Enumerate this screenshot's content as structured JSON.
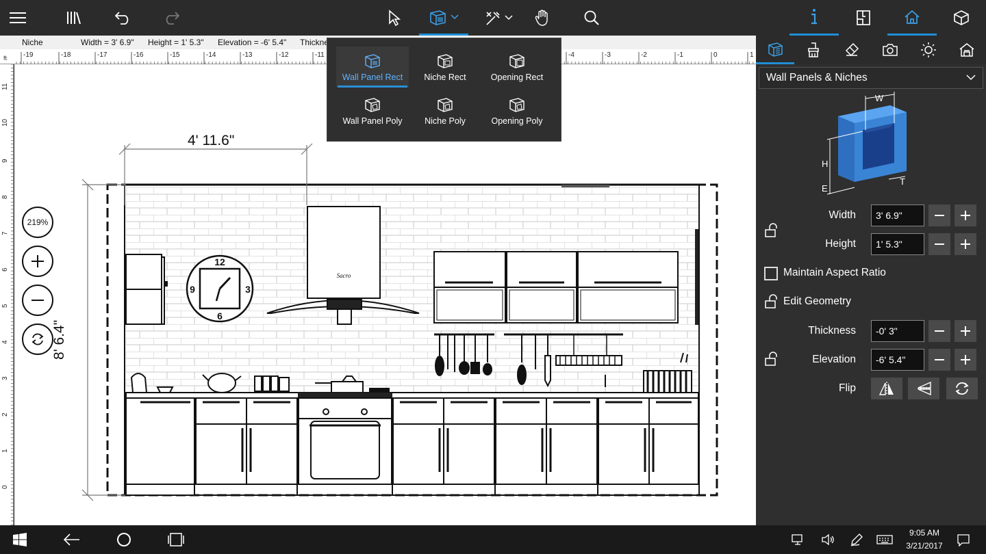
{
  "toolbar": {
    "icons": [
      "menu-icon",
      "library-icon",
      "undo-icon",
      "redo-icon",
      "select-arrow-icon",
      "wall-panel-icon",
      "snap-tools-icon",
      "pan-hand-icon",
      "search-icon",
      "info-icon",
      "floorplan-icon",
      "home-icon",
      "3d-cube-icon"
    ],
    "accent": "#1f8fd6"
  },
  "infobar": {
    "type": "Niche",
    "width": "Width = 3' 6.9\"",
    "height": "Height = 1' 5.3\"",
    "elevation": "Elevation = -6' 5.4\"",
    "thickness_partial": "Thickne"
  },
  "ruler": {
    "h_labels": [
      "-19",
      "-18",
      "-17",
      "-16",
      "-15",
      "-14",
      "-13",
      "-12",
      "-11",
      "-4",
      "-3",
      "-2",
      "-1",
      "0",
      "1"
    ],
    "unit": "ft",
    "v_labels": [
      "11",
      "10",
      "9",
      "8",
      "7",
      "6",
      "5",
      "4",
      "3",
      "2",
      "1",
      "0"
    ]
  },
  "flyout": {
    "items": [
      {
        "label": "Wall Panel Rect",
        "selected": true
      },
      {
        "label": "Niche Rect",
        "selected": false
      },
      {
        "label": "Opening Rect",
        "selected": false
      },
      {
        "label": "Wall Panel Poly",
        "selected": false
      },
      {
        "label": "Niche Poly",
        "selected": false
      },
      {
        "label": "Opening Poly",
        "selected": false
      }
    ]
  },
  "drawing": {
    "dim_width": "4' 11.6\"",
    "dim_height": "8' 6.4\""
  },
  "zoom": {
    "level": "219%"
  },
  "panel": {
    "category": "Wall Panels & Niches",
    "diagram_labels": {
      "w": "W",
      "h": "H",
      "e": "E",
      "t": "T"
    },
    "width_label": "Width",
    "width_value": "3' 6.9\"",
    "height_label": "Height",
    "height_value": "1' 5.3\"",
    "aspect_label": "Maintain Aspect Ratio",
    "edit_geometry_label": "Edit Geometry",
    "thickness_label": "Thickness",
    "thickness_value": "-0' 3\"",
    "elevation_label": "Elevation",
    "elevation_value": "-6' 5.4\"",
    "flip_label": "Flip"
  },
  "taskbar": {
    "time": "9:05 AM",
    "date": "3/21/2017"
  }
}
